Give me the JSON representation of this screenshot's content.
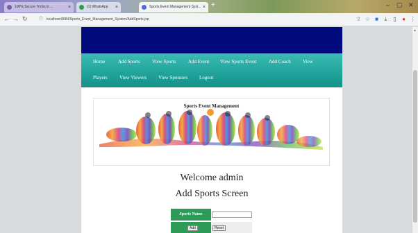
{
  "browser": {
    "tabs": [
      {
        "label": "100% Secure Tricks to ..."
      },
      {
        "label": "(1) WhatsApp"
      },
      {
        "label": "Sports Event Management Syst..."
      }
    ],
    "new_tab": "+",
    "url": "localhost:8084/Sports_Event_Management_System/AddSports.jsp",
    "window_controls": [
      "–",
      "▢",
      "✕"
    ]
  },
  "nav": {
    "row1": [
      "Home",
      "Add Sports",
      "View Sports",
      "Add Event",
      "View Sports Event",
      "Add Coach",
      "View"
    ],
    "row2": [
      "Players",
      "View Viewers",
      "View Sponsors",
      "Logout"
    ]
  },
  "hero": {
    "title": "Sports Event Management"
  },
  "welcome": "Welcome admin",
  "screen_title": "Add Sports Screen",
  "form": {
    "sports_name_label": "Sports Name",
    "sports_name_value": "",
    "add_label": "Add",
    "reset_label": "Reset"
  }
}
